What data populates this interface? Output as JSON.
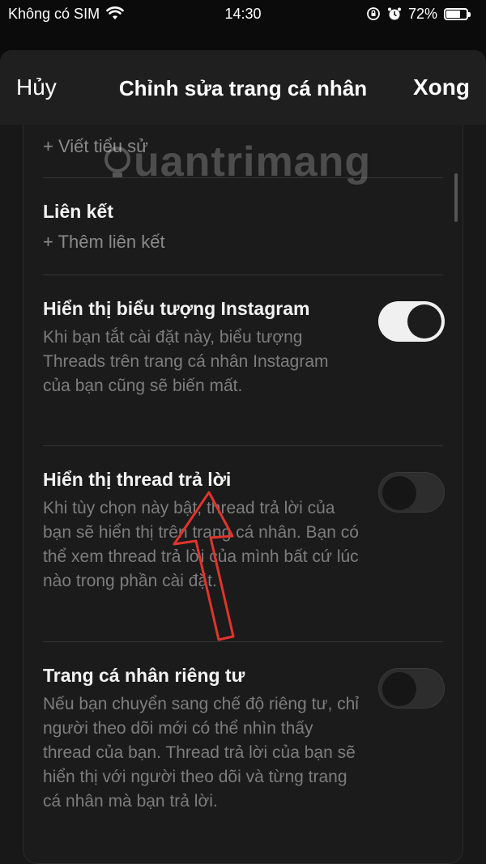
{
  "status": {
    "carrier": "Không có SIM",
    "time": "14:30",
    "battery": "72%",
    "battery_level": 0.72
  },
  "nav": {
    "cancel": "Hủy",
    "title": "Chỉnh sửa trang cá nhân",
    "done": "Xong"
  },
  "bio": {
    "placeholder": "+ Viết tiểu sử"
  },
  "links": {
    "label": "Liên kết",
    "add": "+ Thêm liên kết"
  },
  "settings": [
    {
      "label": "Hiển thị biểu tượng Instagram",
      "desc": "Khi bạn tắt cài đặt này, biểu tượng Threads trên trang cá nhân Instagram của bạn cũng sẽ biến mất.",
      "on": true
    },
    {
      "label": "Hiển thị thread trả lời",
      "desc": "Khi tùy chọn này bật, thread trả lời của bạn sẽ hiển thị trên trang cá nhân. Bạn có thể xem thread trả lời của mình bất cứ lúc nào trong phần cài đặt.",
      "on": false
    },
    {
      "label": "Trang cá nhân riêng tư",
      "desc": "Nếu bạn chuyển sang chế độ riêng tư, chỉ người theo dõi mới có thể nhìn thấy thread của bạn. Thread trả lời của bạn sẽ hiển thị với người theo dõi và từng trang cá nhân mà bạn trả lời.",
      "on": false
    }
  ],
  "watermark": "uantrimang",
  "colors": {
    "annotation_arrow": "#e0342c"
  }
}
